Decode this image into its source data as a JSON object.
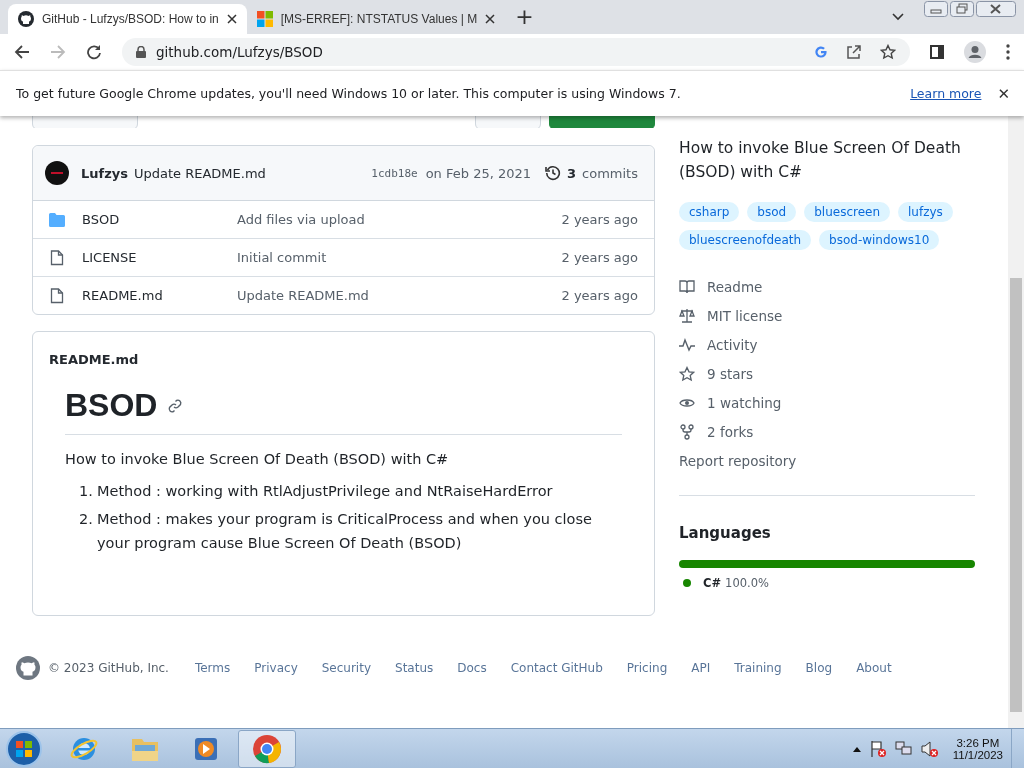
{
  "browser": {
    "tabs": [
      {
        "kind": "github",
        "title": "GitHub - Lufzys/BSOD: How to in",
        "selected": true
      },
      {
        "kind": "microsoft",
        "title": "[MS-ERREF]: NTSTATUS Values | M",
        "selected": false
      }
    ],
    "new_tab": "+",
    "address": "github.com/Lufzys/BSOD"
  },
  "infobar": {
    "message": "To get future Google Chrome updates, you'll need Windows 10 or later. This computer is using Windows 7.",
    "link": "Learn more",
    "close": "✕"
  },
  "commit": {
    "author": "Lufzys",
    "message": "Update README.md",
    "sha": "1cdb18e",
    "date": "on Feb 25, 2021",
    "count": "3",
    "count_label": "commits"
  },
  "files": [
    {
      "kind": "folder",
      "name": "BSOD",
      "message": "Add files via upload",
      "age": "2 years ago"
    },
    {
      "kind": "file",
      "name": "LICENSE",
      "message": "Initial commit",
      "age": "2 years ago"
    },
    {
      "kind": "file",
      "name": "README.md",
      "message": "Update README.md",
      "age": "2 years ago"
    }
  ],
  "readme": {
    "filename": "README.md",
    "heading": "BSOD",
    "intro": "How to invoke Blue Screen Of Death (BSOD) with C#",
    "items": [
      {
        "marker": "1.",
        "text": "Method : working with RtlAdjustPrivilege and NtRaiseHardError"
      },
      {
        "marker": "2.",
        "text": "Method : makes your program is CriticalProcess and when you close your program cause Blue Screen Of Death (BSOD)"
      }
    ]
  },
  "about": {
    "description": "How to invoke Blue Screen Of Death (BSOD) with C#",
    "topics": [
      "csharp",
      "bsod",
      "bluescreen",
      "lufzys",
      "bluescreenofdeath",
      "bsod-windows10"
    ],
    "links": [
      {
        "kind": "book",
        "label": "Readme"
      },
      {
        "kind": "scale",
        "label": "MIT license"
      },
      {
        "kind": "pulse",
        "label": "Activity"
      },
      {
        "kind": "star",
        "label": "9 stars"
      },
      {
        "kind": "eye",
        "label": "1 watching"
      },
      {
        "kind": "fork",
        "label": "2 forks"
      }
    ],
    "report": "Report repository"
  },
  "languages": {
    "title": "Languages",
    "items": [
      {
        "name": "C#",
        "percent": "100.0%",
        "color": "#178600",
        "level": 1.0
      }
    ]
  },
  "footer": {
    "copyright": "© 2023 GitHub, Inc.",
    "links": [
      "Terms",
      "Privacy",
      "Security",
      "Status",
      "Docs",
      "Contact GitHub",
      "Pricing",
      "API",
      "Training",
      "Blog",
      "About"
    ]
  },
  "taskbar": {
    "apps": [
      {
        "kind": "ie",
        "selected": false
      },
      {
        "kind": "explorer",
        "selected": false
      },
      {
        "kind": "media",
        "selected": false
      },
      {
        "kind": "chrome",
        "selected": true
      }
    ],
    "time": "3:26 PM",
    "date": "11/1/2023"
  }
}
